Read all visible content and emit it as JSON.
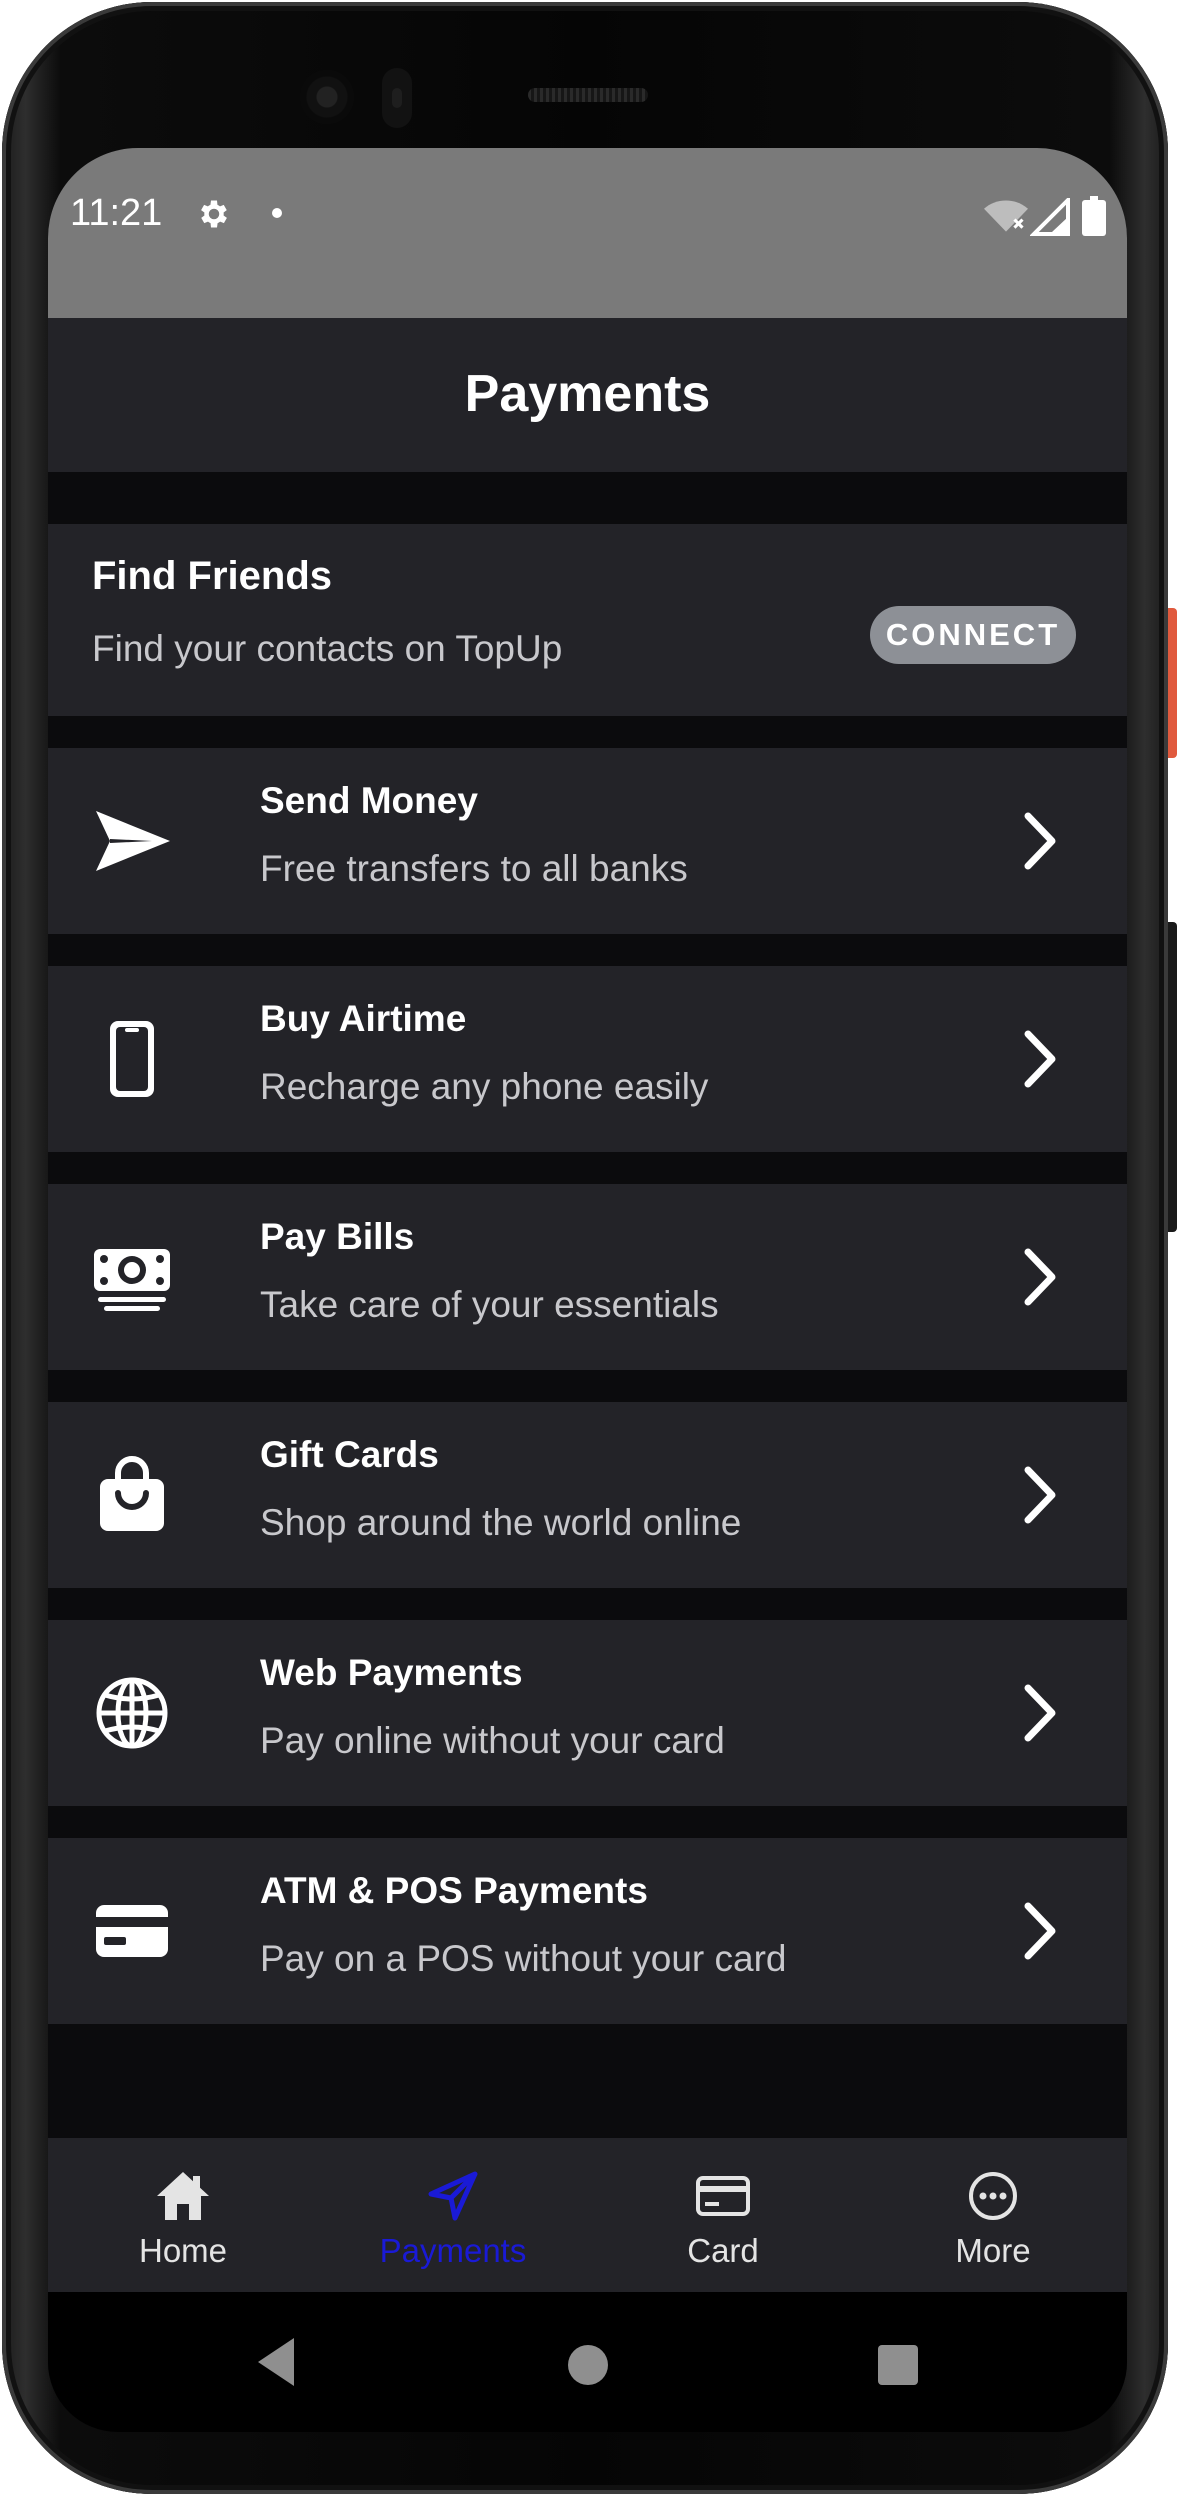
{
  "status_bar": {
    "time": "11:21"
  },
  "app_bar": {
    "title": "Payments"
  },
  "find_friends": {
    "title": "Find Friends",
    "subtitle": "Find your contacts on TopUp",
    "button_label": "CONNECT"
  },
  "services": [
    {
      "icon": "send-icon",
      "title": "Send Money",
      "subtitle": "Free transfers to all banks"
    },
    {
      "icon": "phone-icon",
      "title": "Buy Airtime",
      "subtitle": "Recharge any phone easily"
    },
    {
      "icon": "bills-money-icon",
      "title": "Pay Bills",
      "subtitle": "Take care of your essentials"
    },
    {
      "icon": "shopping-bag-icon",
      "title": "Gift Cards",
      "subtitle": "Shop around the world online"
    },
    {
      "icon": "globe-icon",
      "title": "Web Payments",
      "subtitle": "Pay online without your card"
    },
    {
      "icon": "credit-card-icon",
      "title": "ATM & POS Payments",
      "subtitle": "Pay on a POS without your card"
    }
  ],
  "bottom_nav": {
    "items": [
      {
        "icon": "home-icon",
        "label": "Home",
        "active": false
      },
      {
        "icon": "send-outline-icon",
        "label": "Payments",
        "active": true
      },
      {
        "icon": "card-icon",
        "label": "Card",
        "active": false
      },
      {
        "icon": "more-icon",
        "label": "More",
        "active": false
      }
    ],
    "active_color": "#1a1ad6"
  },
  "colors": {
    "background": "#0b0b0d",
    "surface": "#232328",
    "status_bar": "#7a7a7a",
    "connect_button": "#8d9096",
    "accent": "#e05a3e"
  }
}
